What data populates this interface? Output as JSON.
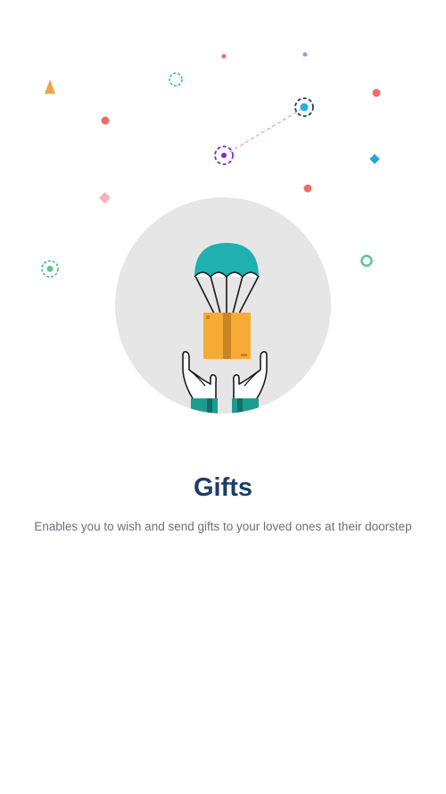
{
  "onboarding": {
    "title": "Gifts",
    "description": "Enables you to wish and send gifts to your loved ones at their doorstep"
  },
  "colors": {
    "background": "#ffffff",
    "title": "#1e3d6b",
    "description": "#6f6f77",
    "circle": "#e6e6e6",
    "parachute": "#1fb0b0",
    "box": "#f6ab35",
    "box_tape": "#c98426",
    "sleeve": "#1c9c8f"
  },
  "illustration": {
    "icon": "gift-parachute-icon"
  }
}
